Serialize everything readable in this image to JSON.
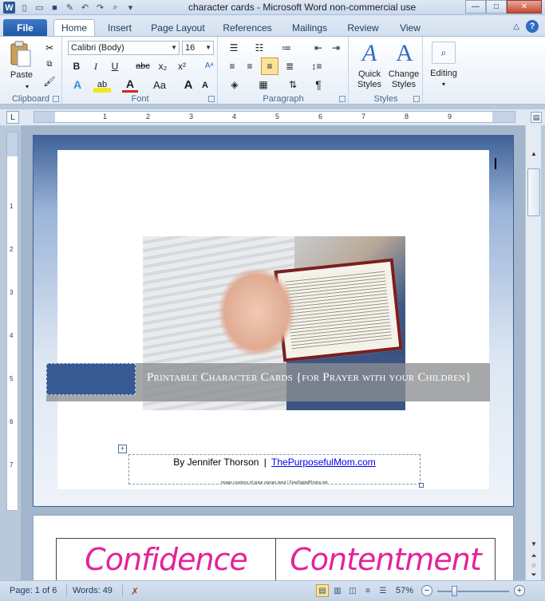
{
  "window": {
    "title": "character cards  -  Microsoft Word non-commercial use",
    "app_icon_letter": "W",
    "controls": {
      "minimize": "—",
      "maximize": "□",
      "close": "✕"
    }
  },
  "quick_access": {
    "icons": [
      "new-document-icon",
      "open-folder-icon",
      "save-icon",
      "document-tools-icon",
      "undo-icon",
      "redo-icon",
      "print-preview-icon",
      "customize-icon"
    ]
  },
  "tabs": [
    "File",
    "Home",
    "Insert",
    "Page Layout",
    "References",
    "Mailings",
    "Review",
    "View"
  ],
  "active_tab": "Home",
  "ribbon": {
    "clipboard": {
      "paste_label": "Paste",
      "group_label": "Clipboard"
    },
    "font": {
      "font_name": "Calibri (Body)",
      "font_size": "16",
      "group_label": "Font",
      "format_buttons": [
        "B",
        "I",
        "U",
        "abc",
        "x₂",
        "x²"
      ],
      "row2_buttons": [
        "A",
        "ab",
        "A",
        "Aa",
        "A",
        "A"
      ]
    },
    "paragraph": {
      "group_label": "Paragraph",
      "pilcrow": "¶"
    },
    "styles": {
      "quick_styles_label": "Quick Styles",
      "change_styles_label": "Change Styles",
      "group_label": "Styles"
    },
    "editing": {
      "label": "Editing"
    }
  },
  "rulers": {
    "horizontal_numbers": [
      "1",
      "2",
      "3",
      "4",
      "5",
      "6",
      "7",
      "8",
      "9"
    ],
    "vertical_numbers": [
      "1",
      "2",
      "3",
      "4",
      "5",
      "6",
      "7"
    ]
  },
  "document": {
    "banner_title": "Printable Character Cards {for Prayer with your Children}",
    "byline_author": "By Jennifer Thorson",
    "byline_separator": "|",
    "byline_link": "ThePurposefulMom.com",
    "image_credit": "image courtesy of graur razvan ionut / FreeDigitalPhotos.net",
    "cards": [
      "Confidence",
      "Contentment"
    ]
  },
  "statusbar": {
    "page": "Page: 1 of 6",
    "words": "Words: 49",
    "zoom": "57%",
    "zoom_level_percent": 57
  }
}
